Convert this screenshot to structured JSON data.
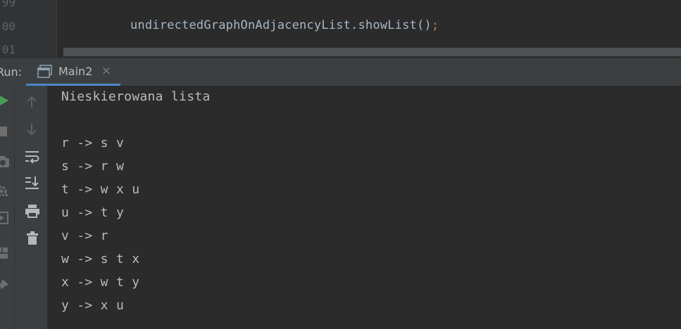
{
  "editor": {
    "line_numbers": [
      "99",
      "00",
      "01"
    ],
    "code_text": "undirectedGraphOnAdjacencyList.showList()",
    "code_terminator": ";"
  },
  "run_window": {
    "label": "Run:",
    "tab": {
      "label": "Main2",
      "close_glyph": "×"
    }
  },
  "toolbar": {
    "left_icons": [
      "run-icon",
      "stop-icon",
      "camera-icon",
      "settings-icon",
      "restore-layout-icon",
      "layout-icon",
      "pin-icon"
    ],
    "console_icons": [
      "up-arrow-icon",
      "down-arrow-icon",
      "soft-wrap-icon",
      "scroll-to-end-icon",
      "print-icon",
      "trash-icon"
    ]
  },
  "console": {
    "lines": [
      "Nieskierowana lista",
      "",
      "r -> s v",
      "s -> r w",
      "t -> w x u",
      "u -> t y",
      "v -> r",
      "w -> s t x",
      "x -> w t y",
      "y -> x u"
    ]
  },
  "colors": {
    "editor_bg": "#2b2b2b",
    "panel_bg": "#3c3f41",
    "text": "#bbbbbb",
    "accent": "#4a88c7",
    "run_green": "#499c54"
  }
}
